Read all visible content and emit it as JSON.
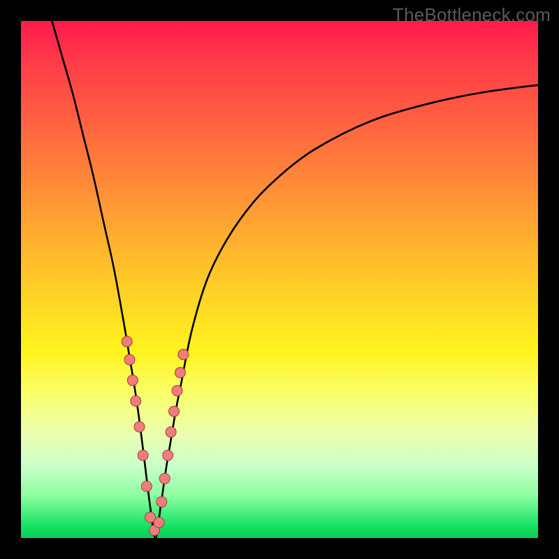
{
  "watermark": "TheBottleneck.com",
  "colors": {
    "frame_bg_top": "#ff1a4d",
    "frame_bg_bottom": "#0ccc55",
    "curve": "#000000",
    "marker_fill": "#ef7d7d",
    "marker_stroke": "#a63a3a",
    "page_bg": "#000000"
  },
  "chart_data": {
    "type": "line",
    "title": "",
    "xlabel": "",
    "ylabel": "",
    "xlim": [
      0,
      100
    ],
    "ylim": [
      0,
      100
    ],
    "grid": false,
    "legend": false,
    "series": [
      {
        "name": "bottleneck-curve",
        "x": [
          6,
          8,
          10,
          12,
          14,
          16,
          18,
          20,
          21,
          22,
          23,
          24,
          25,
          26,
          27,
          28,
          29,
          30,
          31,
          33,
          36,
          40,
          45,
          50,
          55,
          60,
          65,
          70,
          75,
          80,
          85,
          90,
          95,
          100
        ],
        "y": [
          100,
          93,
          86,
          78,
          70,
          61,
          52,
          41,
          35,
          29,
          22,
          14,
          6,
          0,
          6,
          13,
          19,
          25,
          30,
          40,
          50,
          58,
          65,
          70,
          74,
          77,
          79.5,
          81.5,
          83,
          84.3,
          85.4,
          86.3,
          87,
          87.6
        ]
      }
    ],
    "markers": {
      "name": "highlighted-points",
      "x": [
        20.5,
        21.0,
        21.6,
        22.2,
        22.9,
        23.6,
        24.3,
        25.0,
        25.8,
        26.7,
        27.2,
        27.8,
        28.4,
        29.0,
        29.6,
        30.2,
        30.8,
        31.4
      ],
      "y": [
        38.0,
        34.5,
        30.5,
        26.5,
        21.5,
        16.0,
        10.0,
        4.0,
        1.5,
        3.0,
        7.0,
        11.5,
        16.0,
        20.5,
        24.5,
        28.5,
        32.0,
        35.5
      ],
      "r": 7.5
    }
  }
}
